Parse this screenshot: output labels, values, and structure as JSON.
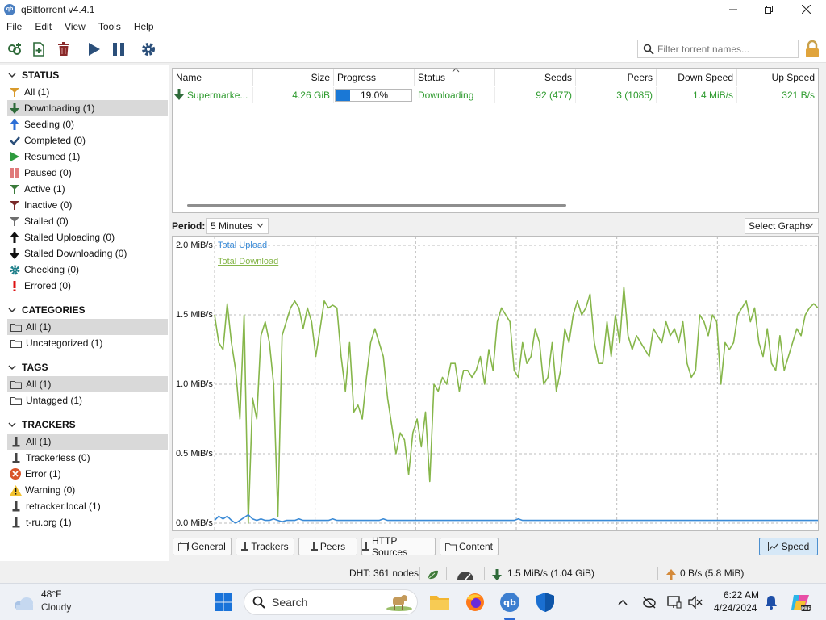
{
  "window": {
    "title": "qBittorrent v4.4.1",
    "app_icon_text": "qb"
  },
  "menu": [
    "File",
    "Edit",
    "View",
    "Tools",
    "Help"
  ],
  "search": {
    "placeholder": "Filter torrent names..."
  },
  "sidebar": {
    "status": {
      "title": "STATUS",
      "items": [
        {
          "label": "All (1)",
          "icon": "filter-icon"
        },
        {
          "label": "Downloading (1)",
          "icon": "arrow-down-icon"
        },
        {
          "label": "Seeding (0)",
          "icon": "arrow-up-icon"
        },
        {
          "label": "Completed (0)",
          "icon": "check-icon"
        },
        {
          "label": "Resumed (1)",
          "icon": "play-icon"
        },
        {
          "label": "Paused (0)",
          "icon": "pause-icon"
        },
        {
          "label": "Active (1)",
          "icon": "filter-icon"
        },
        {
          "label": "Inactive (0)",
          "icon": "filter-icon"
        },
        {
          "label": "Stalled (0)",
          "icon": "filter-icon"
        },
        {
          "label": "Stalled Uploading (0)",
          "icon": "arrow-up-icon"
        },
        {
          "label": "Stalled Downloading (0)",
          "icon": "arrow-down-icon"
        },
        {
          "label": "Checking (0)",
          "icon": "gear-icon"
        },
        {
          "label": "Errored (0)",
          "icon": "exclamation-icon"
        }
      ]
    },
    "categories": {
      "title": "CATEGORIES",
      "items": [
        {
          "label": "All (1)"
        },
        {
          "label": "Uncategorized (1)"
        }
      ]
    },
    "tags": {
      "title": "TAGS",
      "items": [
        {
          "label": "All (1)"
        },
        {
          "label": "Untagged (1)"
        }
      ]
    },
    "trackers": {
      "title": "TRACKERS",
      "items": [
        {
          "label": "All (1)"
        },
        {
          "label": "Trackerless (0)"
        },
        {
          "label": "Error (1)"
        },
        {
          "label": "Warning (0)"
        },
        {
          "label": "retracker.local (1)"
        },
        {
          "label": "t-ru.org (1)"
        }
      ]
    }
  },
  "table": {
    "columns": [
      "Name",
      "Size",
      "Progress",
      "Status",
      "Seeds",
      "Peers",
      "Down Speed",
      "Up Speed"
    ],
    "rows": [
      {
        "name": "Supermarke...",
        "size": "4.26 GiB",
        "progress_text": "19.0%",
        "progress": 0.19,
        "status": "Downloading",
        "seeds": "92 (477)",
        "peers": "3 (1085)",
        "down_speed": "1.4 MiB/s",
        "up_speed": "321 B/s"
      }
    ]
  },
  "graph_controls": {
    "period_label": "Period:",
    "period_value": "5 Minutes",
    "select_graphs": "Select Graphs"
  },
  "graph": {
    "y_labels": [
      "2.0 MiB/s",
      "1.5 MiB/s",
      "1.0 MiB/s",
      "0.5 MiB/s",
      "0.0 MiB/s"
    ],
    "legend_upload": "Total Upload",
    "legend_download": "Total Download",
    "upload_color": "#3a8ad6",
    "download_color": "#86b64a"
  },
  "chart_data": {
    "type": "line",
    "ylim": [
      0,
      2.0
    ],
    "yticks": [
      "2.0 MiB/s",
      "1.5 MiB/s",
      "1.0 MiB/s",
      "0.5 MiB/s",
      "0.0 MiB/s"
    ],
    "grid": true,
    "legend_position": "top-left",
    "series": [
      {
        "name": "Total Download",
        "color": "#86b64a",
        "values": [
          1.5,
          1.3,
          1.25,
          1.58,
          1.3,
          1.1,
          0.75,
          1.5,
          0.0,
          0.9,
          0.75,
          1.35,
          1.45,
          1.3,
          1.0,
          0.05,
          1.35,
          1.45,
          1.55,
          1.6,
          1.55,
          1.4,
          1.55,
          1.45,
          1.2,
          1.4,
          1.6,
          1.55,
          1.57,
          1.55,
          1.2,
          0.95,
          1.3,
          0.8,
          0.85,
          0.75,
          1.05,
          1.3,
          1.4,
          1.3,
          1.2,
          0.9,
          0.7,
          0.5,
          0.65,
          0.6,
          0.35,
          0.65,
          0.75,
          0.55,
          0.8,
          0.3,
          1.0,
          0.95,
          1.05,
          1.0,
          1.15,
          1.15,
          0.95,
          1.1,
          1.1,
          1.05,
          1.1,
          1.2,
          1.0,
          1.25,
          1.1,
          1.45,
          1.55,
          1.5,
          1.45,
          1.1,
          1.05,
          1.3,
          1.15,
          1.2,
          1.4,
          1.3,
          1.0,
          1.05,
          1.3,
          0.95,
          1.1,
          1.4,
          1.3,
          1.5,
          1.6,
          1.5,
          1.55,
          1.65,
          1.3,
          1.15,
          1.15,
          1.45,
          1.2,
          1.5,
          1.3,
          1.7,
          1.35,
          1.25,
          1.35,
          1.3,
          1.25,
          1.2,
          1.4,
          1.35,
          1.3,
          1.45,
          1.35,
          1.4,
          1.3,
          1.45,
          1.15,
          1.05,
          1.1,
          1.5,
          1.45,
          1.35,
          1.5,
          1.45,
          1.0,
          1.3,
          1.25,
          1.3,
          1.5,
          1.55,
          1.6,
          1.45,
          1.55,
          1.3,
          1.2,
          1.4,
          1.15,
          1.1,
          1.35,
          1.1,
          1.2,
          1.3,
          1.4,
          1.35,
          1.5,
          1.55,
          1.58,
          1.55
        ]
      },
      {
        "name": "Total Upload",
        "color": "#3a8ad6",
        "values": [
          0.02,
          0.05,
          0.03,
          0.05,
          0.02,
          0.0,
          0.02,
          0.04,
          0.06,
          0.03,
          0.02,
          0.03,
          0.02,
          0.02,
          0.03,
          0.02,
          0.01,
          0.02,
          0.02,
          0.02,
          0.03,
          0.02,
          0.02,
          0.02,
          0.02,
          0.02,
          0.02,
          0.02,
          0.03,
          0.02,
          0.02,
          0.02,
          0.02,
          0.02,
          0.02,
          0.02,
          0.02,
          0.02,
          0.02,
          0.02,
          0.03,
          0.02,
          0.02,
          0.02,
          0.02,
          0.02,
          0.02,
          0.02,
          0.02,
          0.02,
          0.02,
          0.02,
          0.02,
          0.02,
          0.02,
          0.02,
          0.02,
          0.02,
          0.02,
          0.02,
          0.02,
          0.02,
          0.02,
          0.02,
          0.02,
          0.02,
          0.02,
          0.02,
          0.02,
          0.02,
          0.02,
          0.02,
          0.03,
          0.02,
          0.02,
          0.02,
          0.02,
          0.02,
          0.02,
          0.02,
          0.02,
          0.02,
          0.02,
          0.02,
          0.02,
          0.02,
          0.02,
          0.02,
          0.02,
          0.02,
          0.02,
          0.02,
          0.02,
          0.02,
          0.02,
          0.02,
          0.02,
          0.02,
          0.02,
          0.02,
          0.02,
          0.02,
          0.02,
          0.02,
          0.02,
          0.02,
          0.02,
          0.02,
          0.02,
          0.02,
          0.02,
          0.02,
          0.02,
          0.02,
          0.02,
          0.02,
          0.02,
          0.02,
          0.02,
          0.02,
          0.02,
          0.02,
          0.02,
          0.02,
          0.02,
          0.02,
          0.02,
          0.02,
          0.02,
          0.02,
          0.02,
          0.02,
          0.02,
          0.02,
          0.02,
          0.02,
          0.02,
          0.02,
          0.02,
          0.02,
          0.02,
          0.02,
          0.02,
          0.02
        ]
      }
    ]
  },
  "tabs": [
    "General",
    "Trackers",
    "Peers",
    "HTTP Sources",
    "Content",
    "Speed"
  ],
  "statusbar": {
    "dht": "DHT: 361 nodes",
    "download": "1.5 MiB/s (1.04 GiB)",
    "upload": "0 B/s (5.8 MiB)"
  },
  "taskbar": {
    "weather_temp": "48°F",
    "weather_desc": "Cloudy",
    "search_label": "Search",
    "time": "6:22 AM",
    "date": "4/24/2024"
  }
}
